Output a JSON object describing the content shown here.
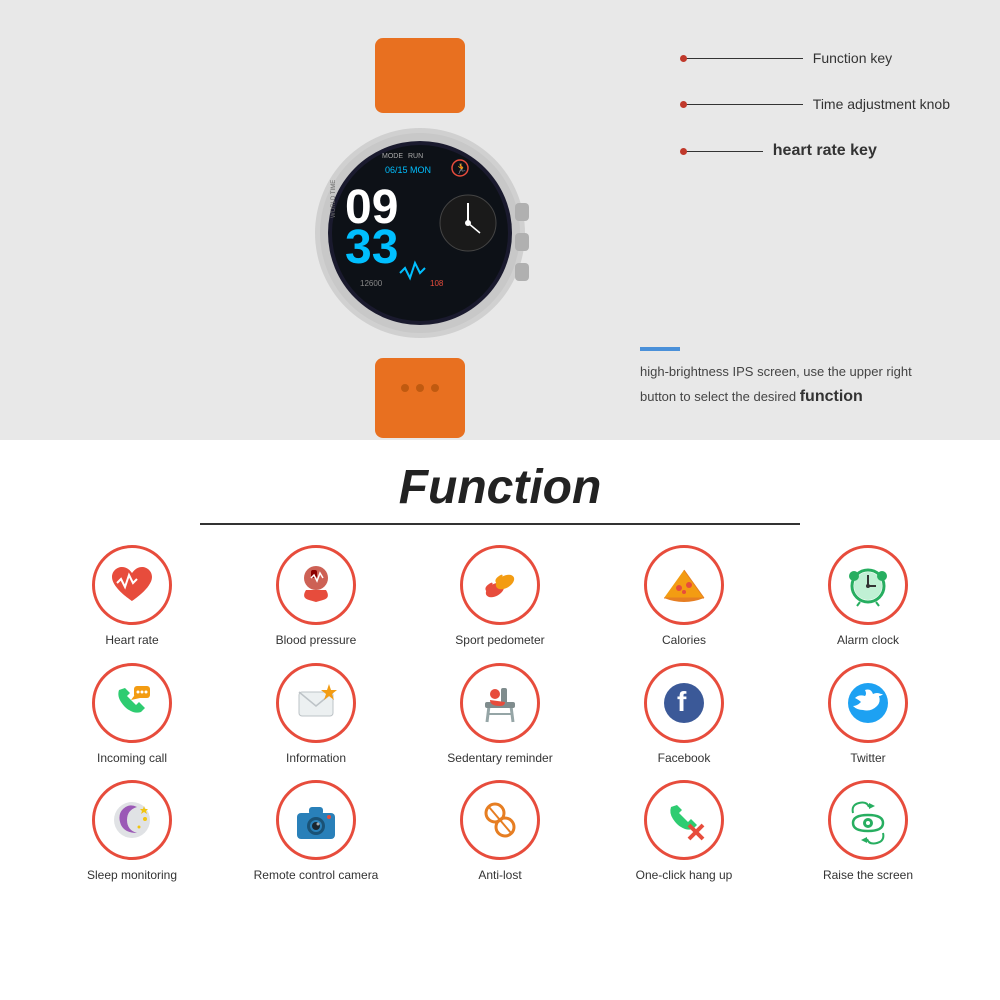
{
  "page": {
    "background_top": "#e8e8e8",
    "background_bottom": "#ffffff"
  },
  "watch": {
    "alt": "Smartwatch with orange strap"
  },
  "labels": [
    {
      "id": "function-key",
      "text": "Function key"
    },
    {
      "id": "time-adjustment-knob",
      "text": "Time adjustment knob"
    },
    {
      "id": "heart-rate-key",
      "text": "heart rate key",
      "bold": true
    }
  ],
  "description": {
    "text1": "high-brightness IPS screen, use the upper right button to select the desired ",
    "highlight": "function"
  },
  "section_title": "Function",
  "functions": [
    {
      "id": "heart-rate",
      "label": "Heart rate",
      "emoji": "❤️",
      "icon_type": "heart_rate"
    },
    {
      "id": "blood-pressure",
      "label": "Blood pressure",
      "emoji": "🩸",
      "icon_type": "blood_pressure"
    },
    {
      "id": "sport-pedometer",
      "label": "Sport pedometer",
      "emoji": "👟",
      "icon_type": "sport"
    },
    {
      "id": "calories",
      "label": "Calories",
      "emoji": "🍕",
      "icon_type": "calories"
    },
    {
      "id": "alarm-clock",
      "label": "Alarm clock",
      "emoji": "⏰",
      "icon_type": "alarm"
    },
    {
      "id": "incoming-call",
      "label": "Incoming call",
      "emoji": "📞",
      "icon_type": "call"
    },
    {
      "id": "information",
      "label": "Information",
      "emoji": "✉️",
      "icon_type": "info"
    },
    {
      "id": "sedentary-reminder",
      "label": "Sedentary reminder",
      "emoji": "🪑",
      "icon_type": "sedentary"
    },
    {
      "id": "facebook",
      "label": "Facebook",
      "emoji": "📘",
      "icon_type": "facebook"
    },
    {
      "id": "twitter",
      "label": "Twitter",
      "emoji": "🐦",
      "icon_type": "twitter"
    },
    {
      "id": "sleep-monitoring",
      "label": "Sleep monitoring",
      "emoji": "🌙",
      "icon_type": "sleep"
    },
    {
      "id": "remote-control-camera",
      "label": "Remote control camera",
      "emoji": "📷",
      "icon_type": "camera"
    },
    {
      "id": "anti-lost",
      "label": "Anti-lost",
      "emoji": "🔗",
      "icon_type": "antilost"
    },
    {
      "id": "one-click-hang-up",
      "label": "One-click hang up",
      "emoji": "📵",
      "icon_type": "hangup"
    },
    {
      "id": "raise-the-screen",
      "label": "Raise the screen",
      "emoji": "👁️",
      "icon_type": "screen"
    }
  ]
}
